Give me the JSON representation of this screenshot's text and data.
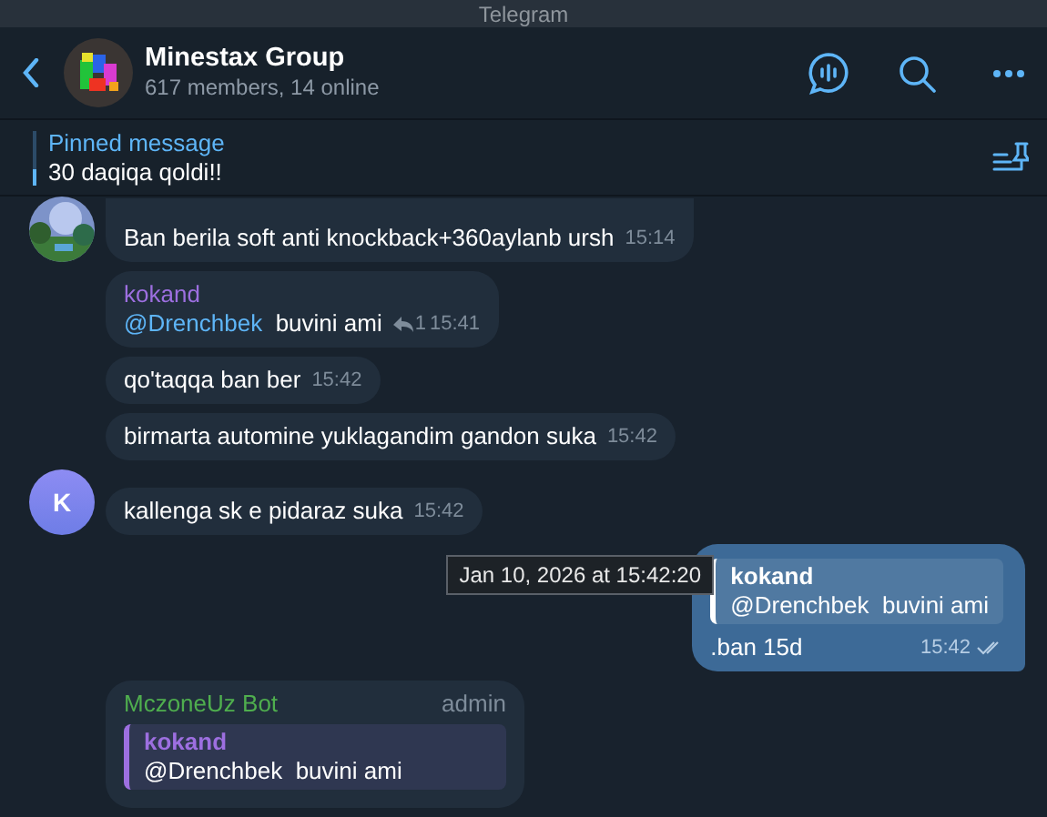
{
  "window": {
    "title": "Telegram"
  },
  "header": {
    "name": "Minestax Group",
    "status": "617 members, 14 online"
  },
  "pinned": {
    "label": "Pinned message",
    "text": "30 daqiqa qoldi!!"
  },
  "messages": [
    {
      "kind": "incoming",
      "text": "Ban berila soft anti knockback+360aylanb ursh",
      "time": "15:14"
    },
    {
      "kind": "incoming",
      "sender": {
        "name": "kokand",
        "color": "#9d6fe0"
      },
      "mention": "@Drenchbek",
      "text": "buvini ami",
      "replies": "1",
      "time": "15:41"
    },
    {
      "kind": "incoming",
      "text": "qo'taqqa ban ber",
      "time": "15:42"
    },
    {
      "kind": "incoming",
      "text": "birmarta automine yuklagandim gandon suka",
      "time": "15:42"
    },
    {
      "kind": "incoming",
      "avatar": {
        "kind": "letter",
        "letter": "K"
      },
      "text": "kallenga sk e pidaraz suka",
      "time": "15:42"
    },
    {
      "kind": "outgoing",
      "tooltip": "Jan 10, 2026 at 15:42:20",
      "quote": {
        "author": "kokand",
        "color": "#ffffff",
        "mention": "@Drenchbek",
        "text": "buvini ami"
      },
      "text": ".ban 15d",
      "time": "15:42",
      "read": true
    },
    {
      "kind": "incoming",
      "sender": {
        "name": "MczoneUz Bot",
        "color": "#4fae4e"
      },
      "role": "admin",
      "quote": {
        "author": "kokand",
        "color": "#9d6fe0",
        "mention": "@Drenchbek",
        "text": "buvini ami"
      }
    }
  ]
}
